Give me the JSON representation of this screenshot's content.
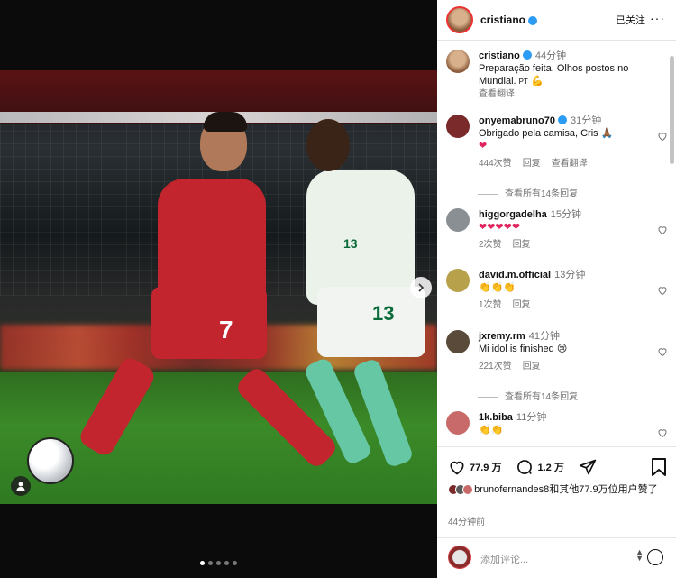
{
  "post": {
    "username": "cristiano",
    "follow_label": "已关注",
    "more_label": "···",
    "caption_user": "cristiano",
    "caption_time": "44分钟",
    "caption_text": "Preparação feita. Olhos postos no Mundial.",
    "caption_suffix": "PT",
    "caption_translate": "查看翻译"
  },
  "photo": {
    "jersey_number_red": "7",
    "jersey_number_white": "13",
    "jersey_number_white_small": "13",
    "carousel_dots": 5,
    "active_dot": 0
  },
  "comments": [
    {
      "user": "onyemabruno70",
      "verified": true,
      "time": "31分钟",
      "text": "Obrigado pela camisa, Cris 🙏🏾",
      "line2": "❤",
      "likes": "444次赞",
      "reply": "回复",
      "translate": "查看翻译",
      "replies_label": "查看所有14条回复",
      "avatar_color": "#7a2a2a"
    },
    {
      "user": "higgorgadelha",
      "verified": false,
      "time": "15分钟",
      "text": "❤❤❤❤❤",
      "likes": "2次赞",
      "reply": "回复",
      "avatar_color": "#8a8f94"
    },
    {
      "user": "david.m.official",
      "verified": false,
      "time": "13分钟",
      "text": "👏👏👏",
      "likes": "1次赞",
      "reply": "回复",
      "avatar_color": "#b7a14a"
    },
    {
      "user": "jxremy.rm",
      "verified": false,
      "time": "41分钟",
      "text": "Mi idol is finished 😢",
      "likes": "221次赞",
      "reply": "回复",
      "replies_label": "查看所有14条回复",
      "avatar_color": "#5a4a3a"
    },
    {
      "user": "1k.biba",
      "verified": false,
      "time": "11分钟",
      "text": "👏👏",
      "avatar_color": "#c86a6a"
    }
  ],
  "actions": {
    "like_count": "77.9 万",
    "comment_count": "1.2 万"
  },
  "likes_line": "brunofernandes8和其他77.9万位用户赞了",
  "posted": "44分钟前",
  "add_comment_placeholder": "添加评论...",
  "colors": {
    "verified": "#2b9bf4",
    "heart": "#e0245e",
    "muted": "#737373"
  }
}
